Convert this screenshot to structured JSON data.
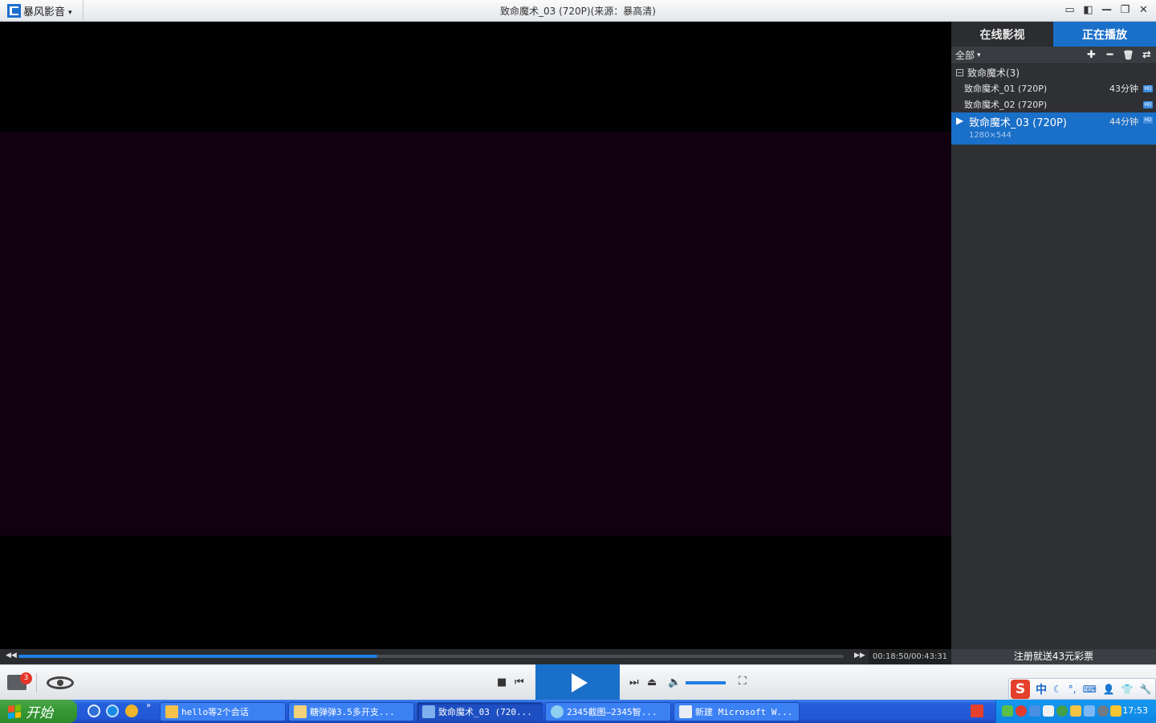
{
  "app": {
    "logo_text": "暴风影音",
    "caret": "▾",
    "window_title": "致命魔术_03 (720P)(来源：暴高清)"
  },
  "window_controls": [
    "▭",
    "◧",
    "—",
    "❐",
    "✕"
  ],
  "sidebar": {
    "tabs": [
      {
        "label": "在线影视",
        "active": false
      },
      {
        "label": "正在播放",
        "active": true
      }
    ],
    "filter_label": "全部",
    "filter_caret": "▾",
    "tool_icons": [
      "add-icon",
      "remove-icon",
      "trash-icon",
      "loop-icon"
    ],
    "tool_glyphs": [
      "✚",
      "━",
      "🗑",
      "⇄"
    ],
    "group": {
      "toggle": "−",
      "label": "致命魔术(3)"
    },
    "items": [
      {
        "name": "致命魔术_01 (720P)",
        "duration": "43分钟",
        "hd": "HD"
      },
      {
        "name": "致命魔术_02 (720P)",
        "duration": "",
        "hd": "HD"
      },
      {
        "name": "致命魔术_03 (720P)",
        "duration": "44分钟",
        "hd": "HD",
        "resolution": "1280×544",
        "playing": true
      }
    ]
  },
  "seek": {
    "rew": "◀◀",
    "ffw": "▶▶",
    "progress": 0.4348,
    "time_text": "00:18:50/00:43:31"
  },
  "promo_text": "注册就送43元彩票",
  "controls": {
    "toolbox_badge": "3",
    "stop": "■",
    "prev": "⏮",
    "next": "⏭",
    "eject": "⏏",
    "volume_icon": "🔈",
    "volume_level": 1.0,
    "fullscreen": "⛶"
  },
  "ime": {
    "logo": "S",
    "mode": "中",
    "icons": [
      "☾",
      "°,",
      "⌨",
      "👤",
      "👕",
      "🔧"
    ]
  },
  "taskbar": {
    "start_label": "开始",
    "quicklaunch_more": "»",
    "tasks": [
      {
        "label": "hello等2个会话",
        "active": false
      },
      {
        "label": "糖弹弹3.5多开支...",
        "active": false
      },
      {
        "label": "致命魔术_03 (720...",
        "active": true
      },
      {
        "label": "2345截图—2345智...",
        "active": false
      },
      {
        "label": "新建 Microsoft W...",
        "active": false
      }
    ],
    "clock": "17:53"
  },
  "colors": {
    "accent": "#1a6fc8",
    "frame": "#11000f"
  }
}
